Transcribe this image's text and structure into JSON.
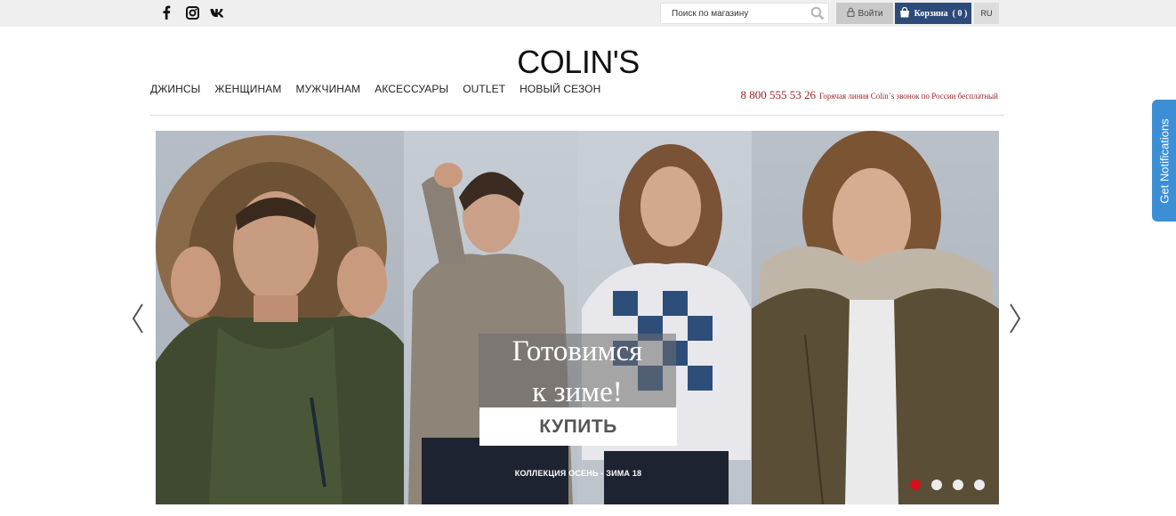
{
  "topbar": {
    "social": [
      {
        "name": "facebook-icon"
      },
      {
        "name": "instagram-icon"
      },
      {
        "name": "vk-icon"
      }
    ],
    "search": {
      "placeholder": "Поиск по магазину"
    },
    "login_label": "Войти",
    "cart_label": "Корзина",
    "cart_count": "( 0 )",
    "lang": "RU"
  },
  "header": {
    "logo": "COLIN'S",
    "nav": [
      "ДЖИНСЫ",
      "ЖЕНЩИНАМ",
      "МУЖЧИНАМ",
      "АКСЕССУАРЫ",
      "OUTLET",
      "НОВЫЙ СЕЗОН"
    ],
    "hotline_phone": "8 800 555 53 26",
    "hotline_note": "Горячая линия Colin`s звонок по России бесплатный"
  },
  "slider": {
    "headline_line1": "Готовимся",
    "headline_line2": "к зиме!",
    "cta": "КУПИТЬ",
    "collection": "КОЛЛЕКЦИЯ ОСЕНЬ - ЗИМА 18",
    "dots_total": 4,
    "active_dot": 1
  },
  "notification_tab": {
    "label": "Get Notifications"
  },
  "colors": {
    "accent_red": "#d4101a",
    "cart_blue": "#2d4a79",
    "notif_blue": "#3d8fd5",
    "hotline_red": "#9b1c1c"
  }
}
